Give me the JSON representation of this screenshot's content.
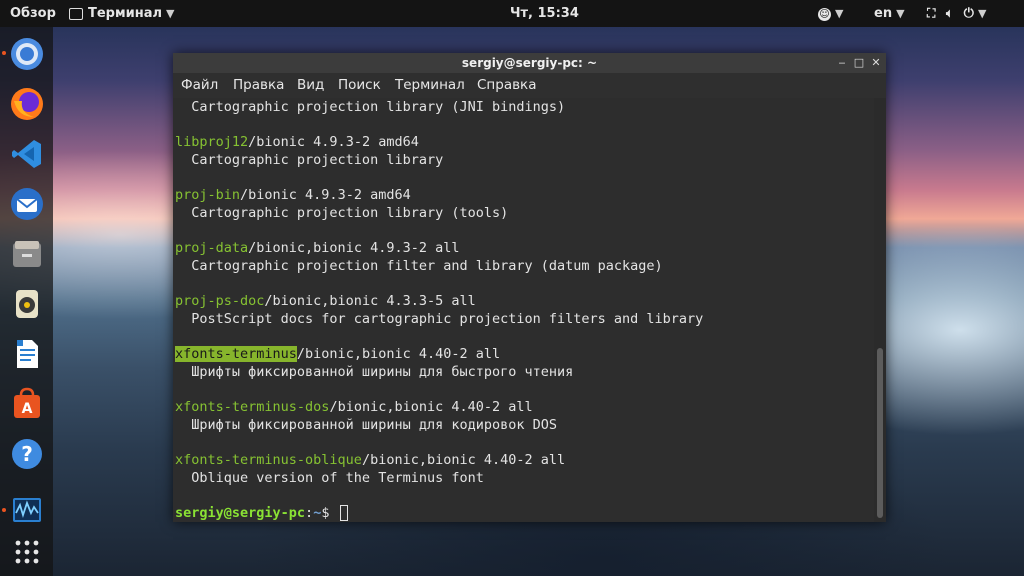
{
  "topbar": {
    "activities": "Обзор",
    "app_menu": "Терминал",
    "clock": "Чт, 15:34",
    "language": "en"
  },
  "dock": {
    "apps": [
      "chromium-icon",
      "firefox-icon",
      "vscode-icon",
      "thunderbird-icon",
      "files-icon",
      "rhythmbox-icon",
      "writer-icon",
      "software-center-icon",
      "help-icon",
      "system-monitor-icon",
      "show-apps-icon"
    ]
  },
  "window": {
    "title": "sergiy@sergiy-pc: ~",
    "menu": [
      "Файл",
      "Правка",
      "Вид",
      "Поиск",
      "Терминал",
      "Справка"
    ]
  },
  "terminal": {
    "lines": [
      {
        "pkg": "",
        "rest": "  Cartographic projection library (JNI bindings)"
      },
      {
        "pkg": "libproj12",
        "rest": "/bionic 4.9.3-2 amd64"
      },
      {
        "pkg": "",
        "rest": "  Cartographic projection library"
      },
      {
        "pkg": "proj-bin",
        "rest": "/bionic 4.9.3-2 amd64"
      },
      {
        "pkg": "",
        "rest": "  Cartographic projection library (tools)"
      },
      {
        "pkg": "proj-data",
        "rest": "/bionic,bionic 4.9.3-2 all"
      },
      {
        "pkg": "",
        "rest": "  Cartographic projection filter and library (datum package)"
      },
      {
        "pkg": "proj-ps-doc",
        "rest": "/bionic,bionic 4.3.3-5 all"
      },
      {
        "pkg": "",
        "rest": "  PostScript docs for cartographic projection filters and library"
      },
      {
        "pkg": "xfonts-terminus",
        "rest": "/bionic,bionic 4.40-2 all"
      },
      {
        "pkg": "",
        "rest": "  Шрифты фиксированной ширины для быстрого чтения"
      },
      {
        "pkg": "xfonts-terminus-dos",
        "rest": "/bionic,bionic 4.40-2 all"
      },
      {
        "pkg": "",
        "rest": "  Шрифты фиксированной ширины для кодировок DOS"
      },
      {
        "pkg": "xfonts-terminus-oblique",
        "rest": "/bionic,bionic 4.40-2 all"
      },
      {
        "pkg": "",
        "rest": "  Oblique version of the Terminus font"
      }
    ],
    "prompt_user": "sergiy@sergiy-pc",
    "prompt_sep": ":",
    "prompt_path": "~",
    "prompt_symbol": "$"
  }
}
